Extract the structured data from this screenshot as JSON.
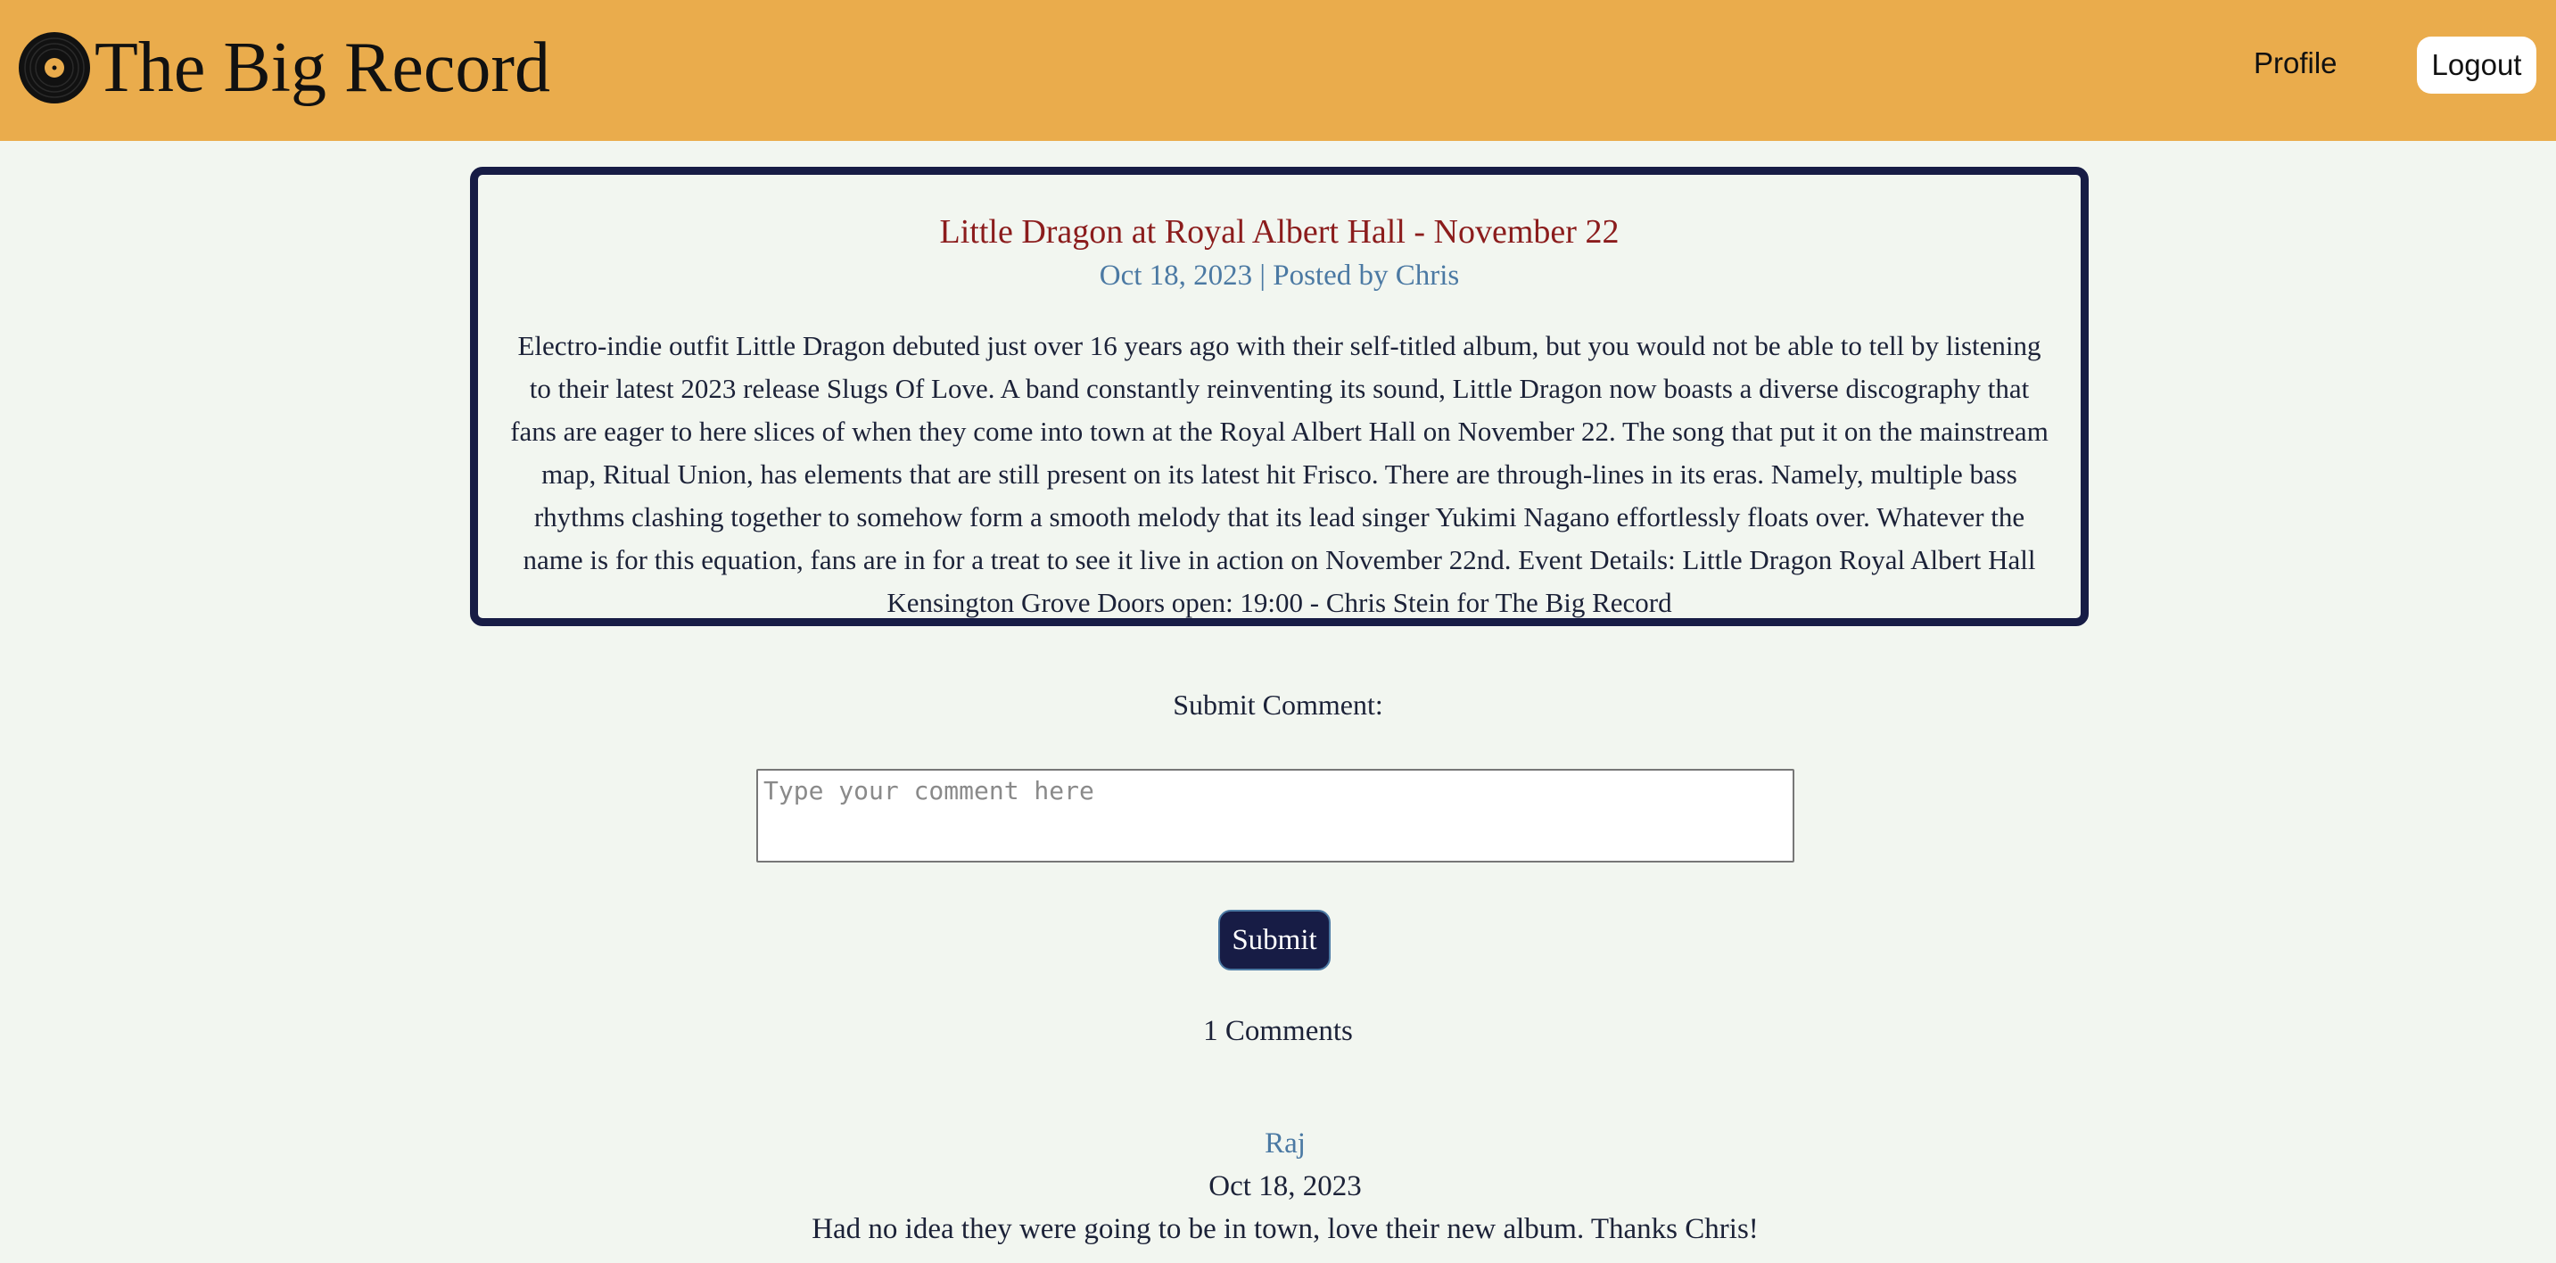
{
  "header": {
    "brand_title": "The Big Record",
    "nav_profile": "Profile",
    "nav_logout": "Logout",
    "background_color": "#eaac4c",
    "logo_icon": "vinyl-record-icon"
  },
  "post": {
    "title": "Little Dragon at Royal Albert Hall - November 22",
    "meta": "Oct 18, 2023 | Posted by Chris",
    "body": "Electro-indie outfit Little Dragon debuted just over 16 years ago with their self-titled album, but you would not be able to tell by listening to their latest 2023 release Slugs Of Love. A band constantly reinventing its sound, Little Dragon now boasts a diverse discography that fans are eager to here slices of when they come into town at the Royal Albert Hall on November 22. The song that put it on the mainstream map, Ritual Union, has elements that are still present on its latest hit Frisco. There are through-lines in its eras. Namely, multiple bass rhythms clashing together to somehow form a smooth melody that its lead singer Yukimi Nagano effortlessly floats over. Whatever the name is for this equation, fans are in for a treat to see it live in action on November 22nd. Event Details: Little Dragon Royal Albert Hall Kensington Grove Doors open: 19:00 - Chris Stein for The Big Record",
    "title_color": "#8b1c1c",
    "meta_color": "#4b79a3",
    "border_color": "#171c45"
  },
  "comment_form": {
    "label": "Submit Comment:",
    "placeholder": "Type your comment here",
    "value": "",
    "submit_label": "Submit"
  },
  "comments": {
    "count_text": "1 Comments",
    "items": [
      {
        "author": "Raj",
        "date": "Oct 18, 2023",
        "text": "Had no idea they were going to be in town, love their new album. Thanks Chris!"
      }
    ]
  }
}
